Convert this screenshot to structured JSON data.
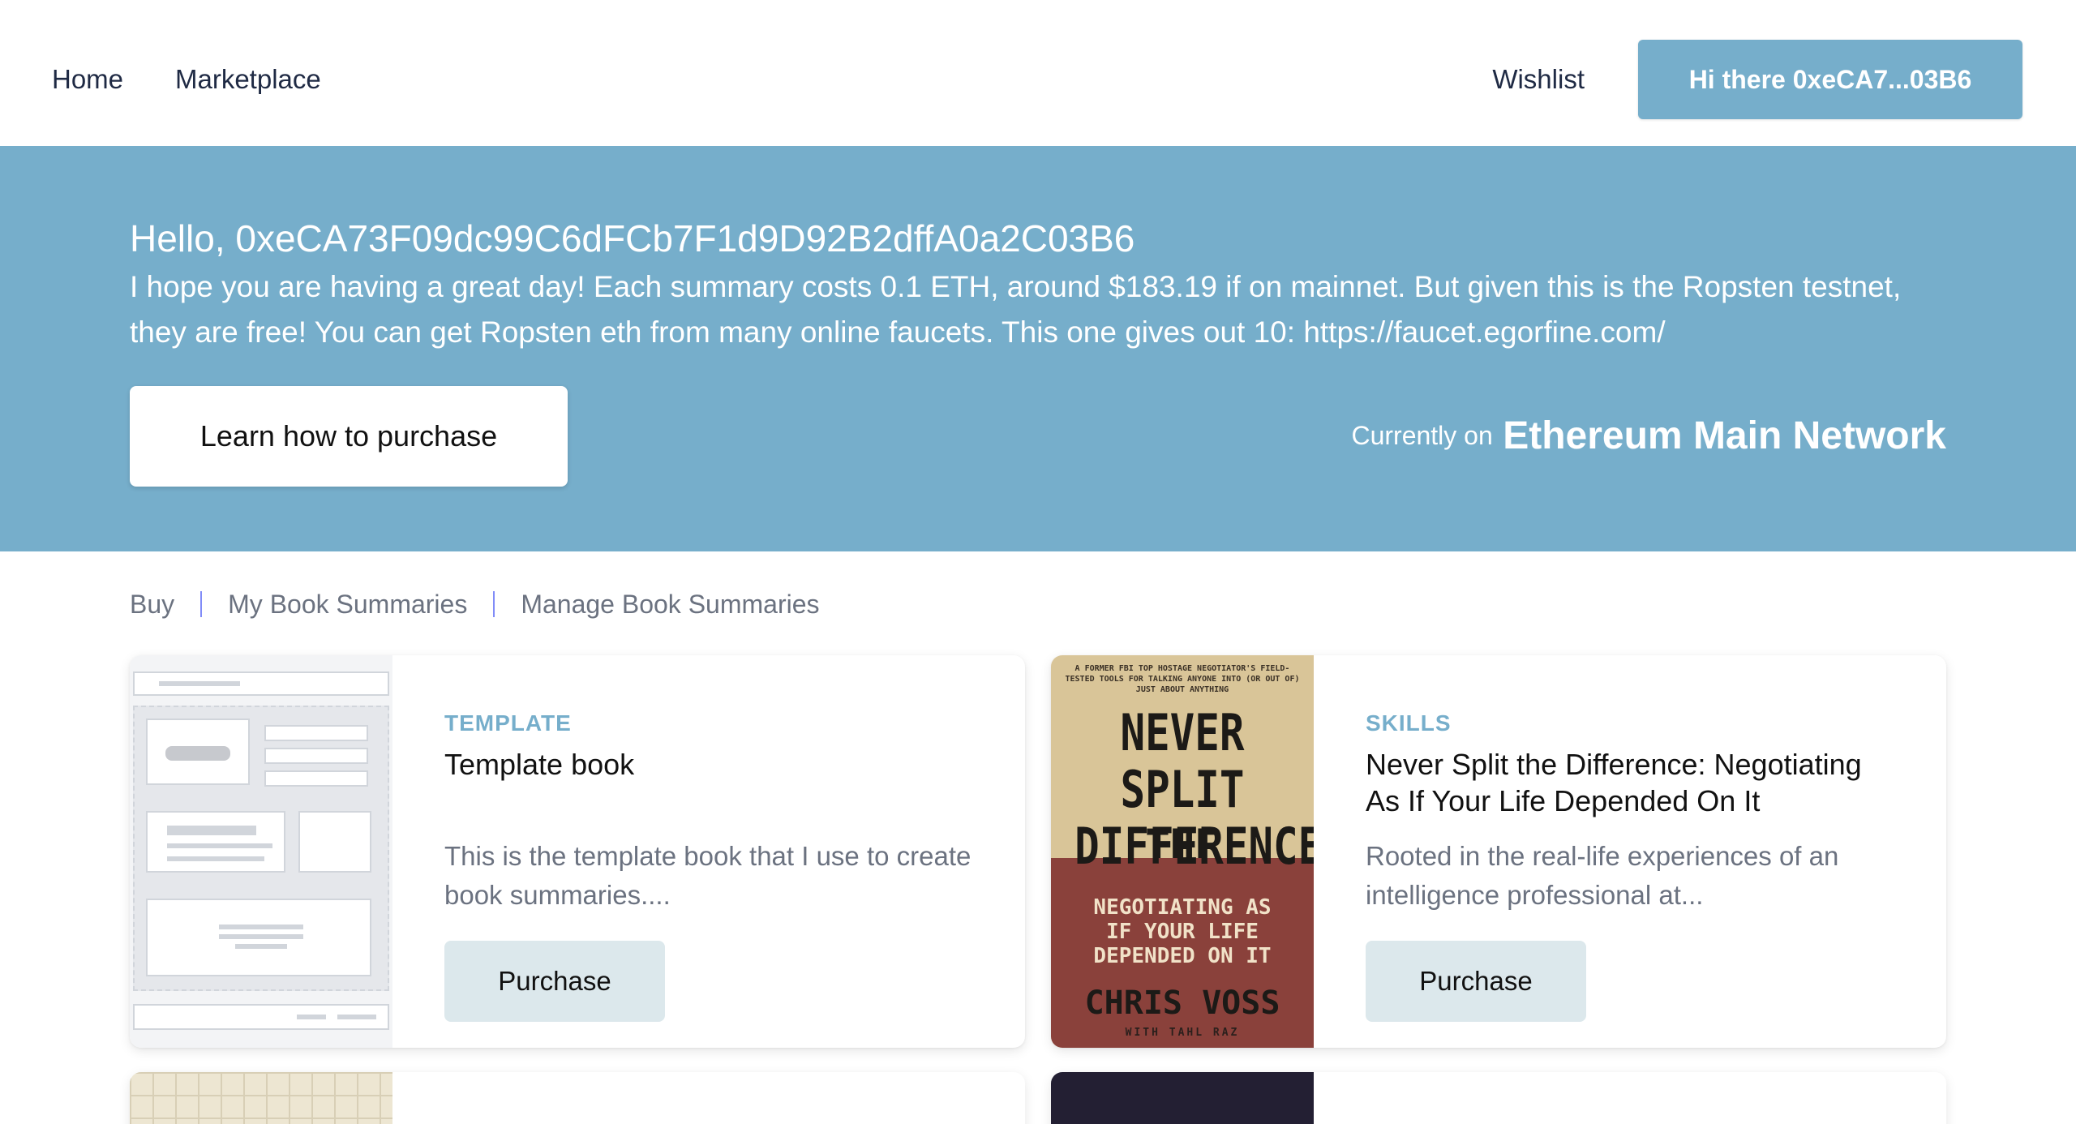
{
  "nav": {
    "home": "Home",
    "marketplace": "Marketplace",
    "wishlist": "Wishlist",
    "account_button": "Hi there 0xeCA7...03B6"
  },
  "hero": {
    "greeting": "Hello, 0xeCA73F09dc99C6dFCb7F1d9D92B2dffA0a2C03B6",
    "message": "I hope you are having a great day! Each summary costs 0.1 ETH, around $183.19 if on mainnet. But given this is the Ropsten testnet, they are free! You can get Ropsten eth from many online faucets. This one gives out 10: https://faucet.egorfine.com/",
    "learn_button": "Learn how to purchase",
    "network_prefix": "Currently on",
    "network_name": "Ethereum Main Network"
  },
  "tabs": [
    "Buy",
    "My Book Summaries",
    "Manage Book Summaries"
  ],
  "cards": [
    {
      "category": "TEMPLATE",
      "title": "Template book",
      "description": "This is the template book that I use to create book summaries....",
      "button": "Purchase",
      "image": "wireframe-template-image"
    },
    {
      "category": "SKILLS",
      "title": "Never Split the Difference: Negotiating As If Your Life Depended On It",
      "description": "Rooted in the real-life experiences of an intelligence professional at...",
      "button": "Purchase",
      "image": "book-cover-never-split-the-difference",
      "cover": {
        "blurb": "A FORMER FBI TOP HOSTAGE NEGOTIATOR'S FIELD-TESTED TOOLS FOR TALKING ANYONE INTO (OR OUT OF) JUST ABOUT ANYTHING",
        "line1": "NEVER",
        "line2": "SPLIT THE",
        "line3": "DIFFERENCE",
        "sub1": "NEGOTIATING AS",
        "sub2": "IF YOUR LIFE",
        "sub3": "DEPENDED ON IT",
        "author": "CHRIS VOSS",
        "coauthor": "WITH TAHL RAZ"
      }
    }
  ],
  "colors": {
    "accent": "#76aecb",
    "button_light": "#dce8ec",
    "text_muted": "#6b7280",
    "tab_separator": "#818cf8"
  }
}
